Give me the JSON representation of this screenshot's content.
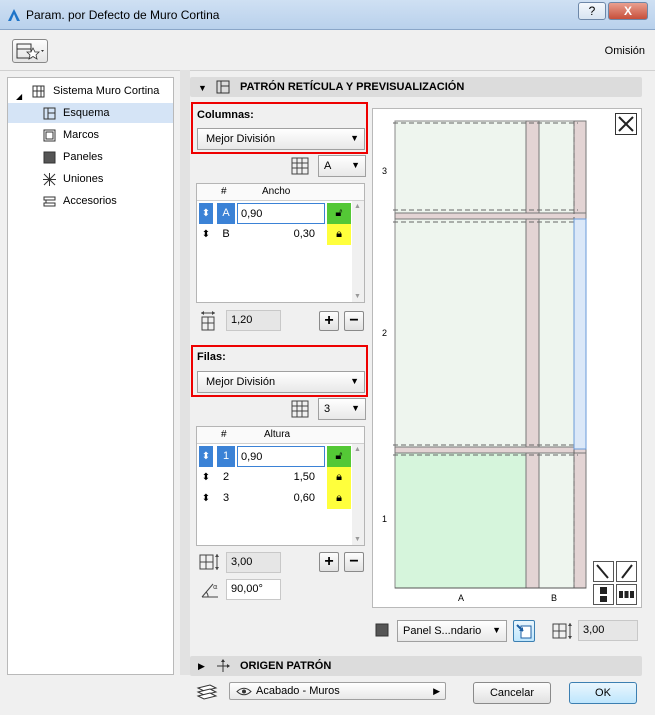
{
  "window": {
    "title": "Param. por Defecto de Muro Cortina",
    "help_label": "?",
    "close_label": "X"
  },
  "header": {
    "omision_label": "Omisión"
  },
  "tree": {
    "root_label": "Sistema Muro Cortina",
    "items": [
      {
        "label": "Esquema",
        "icon": "layout-icon",
        "selected": true
      },
      {
        "label": "Marcos",
        "icon": "frame-icon"
      },
      {
        "label": "Paneles",
        "icon": "panel-icon"
      },
      {
        "label": "Uniones",
        "icon": "junction-icon"
      },
      {
        "label": "Accesorios",
        "icon": "accessory-icon"
      }
    ]
  },
  "section_pattern": {
    "title": "PATRÓN RETÍCULA Y PREVISUALIZACIÓN"
  },
  "columns": {
    "label": "Columnas:",
    "mode_value": "Mejor División",
    "scheme_value": "A",
    "table": {
      "col_hash": "#",
      "col_width": "Ancho",
      "rows": [
        {
          "index": "A",
          "value": "0,90",
          "selected": true
        },
        {
          "index": "B",
          "value": "0,30"
        }
      ]
    },
    "total_value": "1,20"
  },
  "rows": {
    "label": "Filas:",
    "mode_value": "Mejor División",
    "count_value": "3",
    "table": {
      "col_hash": "#",
      "col_height": "Altura",
      "rows": [
        {
          "index": "1",
          "value": "0,90",
          "selected": true
        },
        {
          "index": "2",
          "value": "1,50"
        },
        {
          "index": "3",
          "value": "0,60"
        }
      ]
    },
    "total_value": "3,00",
    "angle_value": "90,00°"
  },
  "preview": {
    "row_labels": [
      "3",
      "2",
      "1"
    ],
    "col_labels": [
      "A",
      "B"
    ],
    "panel_type_value": "Panel S...ndario",
    "height_value": "3,00"
  },
  "section_origin": {
    "title": "ORIGEN PATRÓN"
  },
  "footer": {
    "layer_value": "Acabado - Muros",
    "cancel_label": "Cancelar",
    "ok_label": "OK"
  },
  "colors": {
    "accent_red": "#e00000",
    "lock_yellow": "#ffff3c",
    "lock_green": "#54c836",
    "selection_blue": "#3b82d6",
    "panel_green": "#d6f5dc"
  }
}
